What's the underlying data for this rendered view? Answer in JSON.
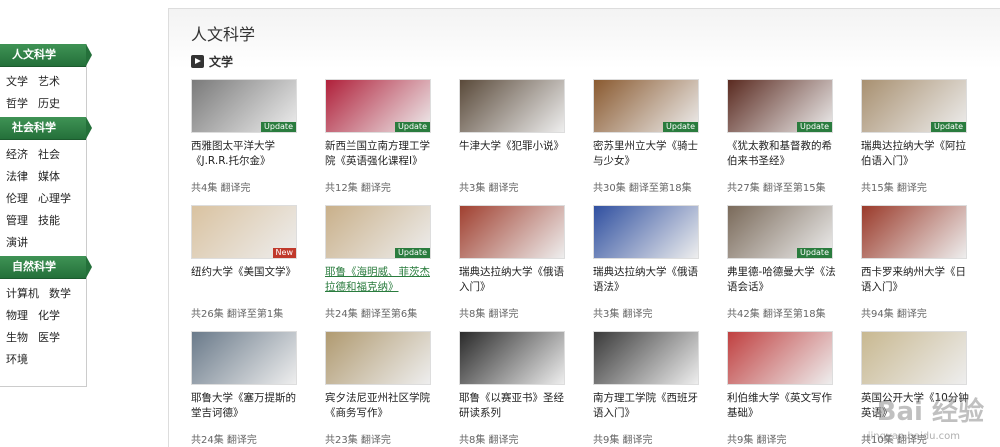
{
  "sidebar": {
    "categories": [
      {
        "title": "人文科学",
        "rows": [
          [
            "文学",
            "艺术"
          ],
          [
            "哲学",
            "历史"
          ]
        ]
      },
      {
        "title": "社会科学",
        "rows": [
          [
            "经济",
            "社会"
          ],
          [
            "法律",
            "媒体"
          ],
          [
            "伦理",
            "心理学"
          ],
          [
            "管理",
            "技能"
          ],
          [
            "演讲"
          ]
        ]
      },
      {
        "title": "自然科学",
        "rows": [
          [
            "计算机",
            "数学"
          ],
          [
            "物理",
            "化学"
          ],
          [
            "生物",
            "医学"
          ],
          [
            "环境"
          ]
        ]
      }
    ]
  },
  "main": {
    "page_title": "人文科学",
    "section_title": "文学",
    "courses": [
      {
        "title": "西雅图太平洋大学《J.R.R.托尔金》",
        "meta": "共4集  翻译完",
        "badge": "Update",
        "color": "#7a7a7a"
      },
      {
        "title": "新西兰国立南方理工学院《英语强化课程I》",
        "meta": "共12集  翻译完",
        "badge": "Update",
        "color": "#b0203a"
      },
      {
        "title": "牛津大学《犯罪小说》",
        "meta": "共3集  翻译完",
        "badge": "",
        "color": "#5a4a3a"
      },
      {
        "title": "密苏里州立大学《骑士与少女》",
        "meta": "共30集  翻译至第18集",
        "badge": "Update",
        "color": "#8a5a30"
      },
      {
        "title": "《犹太教和基督教的希伯来书圣经》",
        "meta": "共27集  翻译至第15集",
        "badge": "Update",
        "color": "#5a2a20"
      },
      {
        "title": "瑞典达拉纳大学《阿拉伯语入门》",
        "meta": "共15集  翻译完",
        "badge": "Update",
        "color": "#a89070"
      },
      {
        "title": "纽约大学《美国文学》",
        "meta": "共26集  翻译至第1集",
        "badge": "New",
        "color": "#d9c2a0"
      },
      {
        "title": "耶鲁《海明威、菲茨杰拉德和福克纳》",
        "meta": "共24集  翻译至第6集",
        "badge": "Update",
        "color": "#c9b08a",
        "link": true
      },
      {
        "title": "瑞典达拉纳大学《俄语入门》",
        "meta": "共8集  翻译完",
        "badge": "",
        "color": "#a04030"
      },
      {
        "title": "瑞典达拉纳大学《俄语语法》",
        "meta": "共3集  翻译完",
        "badge": "",
        "color": "#3050a0"
      },
      {
        "title": "弗里德-哈德曼大学《法语会话》",
        "meta": "共42集  翻译至第18集",
        "badge": "Update",
        "color": "#7a6a5a"
      },
      {
        "title": "西卡罗来纳州大学《日语入门》",
        "meta": "共94集  翻译完",
        "badge": "",
        "color": "#9a3a2a"
      },
      {
        "title": "耶鲁大学《塞万提斯的堂吉诃德》",
        "meta": "共24集  翻译完",
        "badge": "",
        "color": "#6a7a8a"
      },
      {
        "title": "宾夕法尼亚州社区学院《商务写作》",
        "meta": "共23集  翻译完",
        "badge": "",
        "color": "#b09a70"
      },
      {
        "title": "耶鲁《以赛亚书》圣经研读系列",
        "meta": "共8集  翻译完",
        "badge": "",
        "color": "#2a2a2a"
      },
      {
        "title": "南方理工学院《西班牙语入门》",
        "meta": "共9集  翻译完",
        "badge": "",
        "color": "#3a3a3a"
      },
      {
        "title": "利伯维大学《英文写作基础》",
        "meta": "共9集  翻译完",
        "badge": "",
        "color": "#c04040"
      },
      {
        "title": "英国公开大学《10分钟英语》",
        "meta": "共10集  翻译完",
        "badge": "",
        "color": "#c8b890"
      }
    ]
  },
  "watermark": {
    "text": "Bai 经验",
    "url": "jingyan.baidu.com"
  }
}
